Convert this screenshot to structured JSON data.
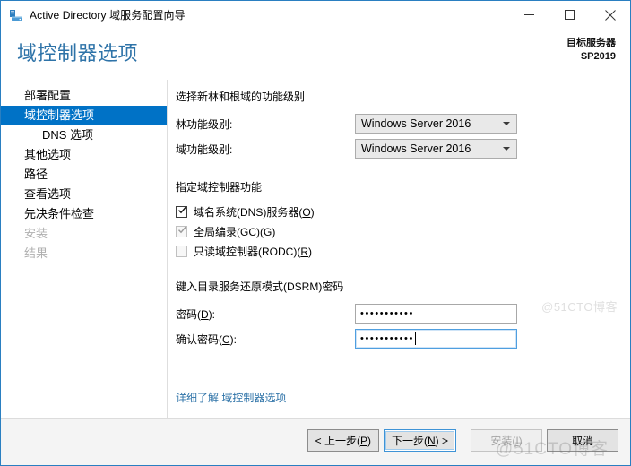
{
  "window": {
    "title": "Active Directory 域服务配置向导",
    "app_icon": "server-icon",
    "minimize_label": "最小化",
    "maximize_label": "最大化",
    "close_label": "关闭"
  },
  "header": {
    "title": "域控制器选项",
    "target_server_label": "目标服务器",
    "target_server_name": "SP2019"
  },
  "sidebar": {
    "items": [
      {
        "label": "部署配置",
        "state": "normal",
        "indent": false
      },
      {
        "label": "域控制器选项",
        "state": "selected",
        "indent": false
      },
      {
        "label": "DNS 选项",
        "state": "normal",
        "indent": true
      },
      {
        "label": "其他选项",
        "state": "normal",
        "indent": false
      },
      {
        "label": "路径",
        "state": "normal",
        "indent": false
      },
      {
        "label": "查看选项",
        "state": "normal",
        "indent": false
      },
      {
        "label": "先决条件检查",
        "state": "normal",
        "indent": false
      },
      {
        "label": "安装",
        "state": "disabled",
        "indent": false
      },
      {
        "label": "结果",
        "state": "disabled",
        "indent": false
      }
    ]
  },
  "main": {
    "functional_level": {
      "section_label": "选择新林和根域的功能级别",
      "forest_label": "林功能级别:",
      "forest_value": "Windows Server 2016",
      "domain_label": "域功能级别:",
      "domain_value": "Windows Server 2016"
    },
    "dc_capabilities": {
      "section_label": "指定域控制器功能",
      "options": [
        {
          "label": "域名系统(DNS)服务器(O)",
          "accel": "O",
          "checked": true,
          "disabled": false
        },
        {
          "label": "全局编录(GC)(G)",
          "accel": "G",
          "checked": true,
          "disabled": true
        },
        {
          "label": "只读域控制器(RODC)(R)",
          "accel": "R",
          "checked": false,
          "disabled": true
        }
      ]
    },
    "dsrm": {
      "section_label": "键入目录服务还原模式(DSRM)密码",
      "password_label": "密码(D):",
      "password_value": "•••••••••••",
      "confirm_label": "确认密码(C):",
      "confirm_value": "•••••••••••"
    },
    "help_link": "详细了解 域控制器选项"
  },
  "footer": {
    "previous_label": "< 上一步(P)",
    "next_label": "下一步(N) >",
    "install_label": "安装(I)",
    "cancel_label": "取消"
  },
  "watermark": {
    "text": "@51CTO博客",
    "mid_text": "@51CTO博客"
  },
  "colors": {
    "accent_blue": "#0072c6",
    "header_blue": "#2e73a8",
    "window_border": "#2a7fc1",
    "footer_bg": "#f4f4f4"
  }
}
